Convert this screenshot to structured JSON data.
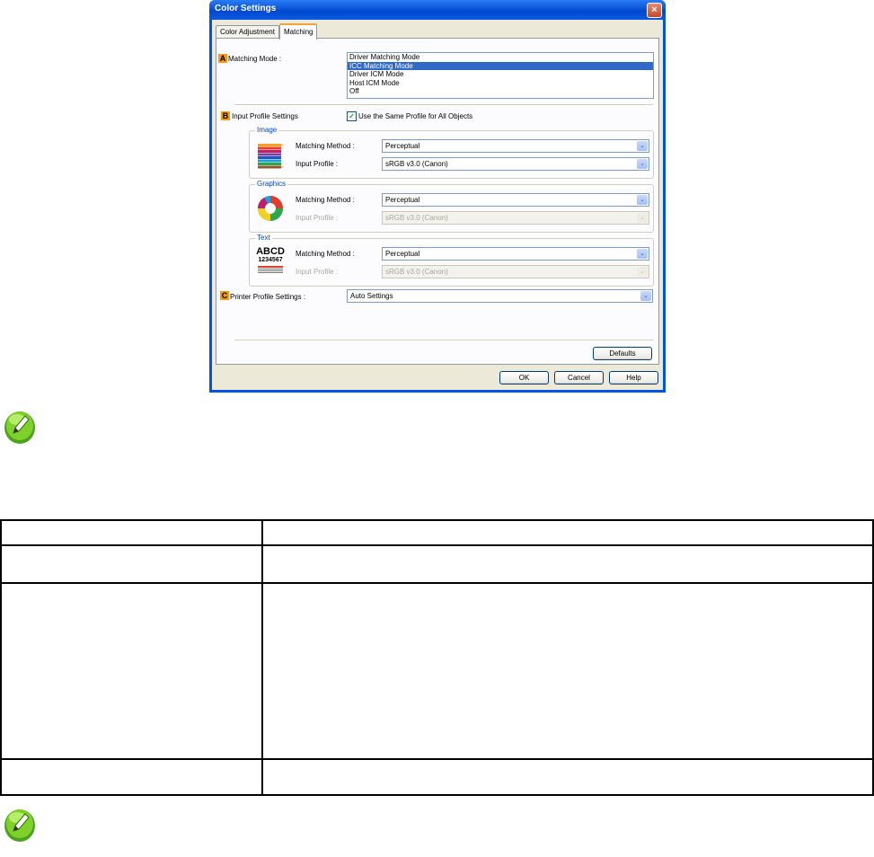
{
  "dialog": {
    "title": "Color Settings",
    "close_glyph": "×",
    "tabs": [
      {
        "label": "Color Adjustment",
        "active": false
      },
      {
        "label": "Matching",
        "active": true
      }
    ],
    "section_a": {
      "badge": "A",
      "label": "Matching Mode :",
      "options": [
        "Driver Matching Mode",
        "ICC Matching Mode",
        "Driver ICM Mode",
        "Host ICM Mode",
        "Off"
      ],
      "selected_index": 1
    },
    "section_b": {
      "badge": "B",
      "label": "Input Profile Settings",
      "checkbox_label": "Use the Same Profile for All Objects",
      "checkbox_checked": true,
      "checkmark_glyph": "✓",
      "groups": [
        {
          "title": "Image",
          "icon": "color-pencils-icon",
          "method_label": "Matching Method :",
          "method_value": "Perceptual",
          "profile_label": "Input Profile :",
          "profile_value": "sRGB v3.0 (Canon)",
          "profile_enabled": true
        },
        {
          "title": "Graphics",
          "icon": "color-wheel-icon",
          "method_label": "Matching Method :",
          "method_value": "Perceptual",
          "profile_label": "Input Profile :",
          "profile_value": "sRGB v3.0 (Canon)",
          "profile_enabled": false
        },
        {
          "title": "Text",
          "icon": "text-sample-icon",
          "icon_text_line1": "ABCD",
          "icon_text_line2": "1234567",
          "method_label": "Matching Method :",
          "method_value": "Perceptual",
          "profile_label": "Input Profile :",
          "profile_value": "sRGB v3.0 (Canon)",
          "profile_enabled": false
        }
      ]
    },
    "section_c": {
      "badge": "C",
      "label": "Printer Profile Settings :",
      "value": "Auto Settings"
    },
    "dropdown_glyph": "⌄",
    "buttons": {
      "defaults": "Defaults",
      "ok": "OK",
      "cancel": "Cancel",
      "help": "Help"
    }
  },
  "colors": {
    "title_bar": "#0a56d8",
    "badge": "#f39c12",
    "selection": "#316ac5",
    "group_title": "#0046d5",
    "note_icon": "#7fd12a"
  },
  "note_icons": [
    "note-pencil-icon",
    "note-pencil-icon"
  ]
}
